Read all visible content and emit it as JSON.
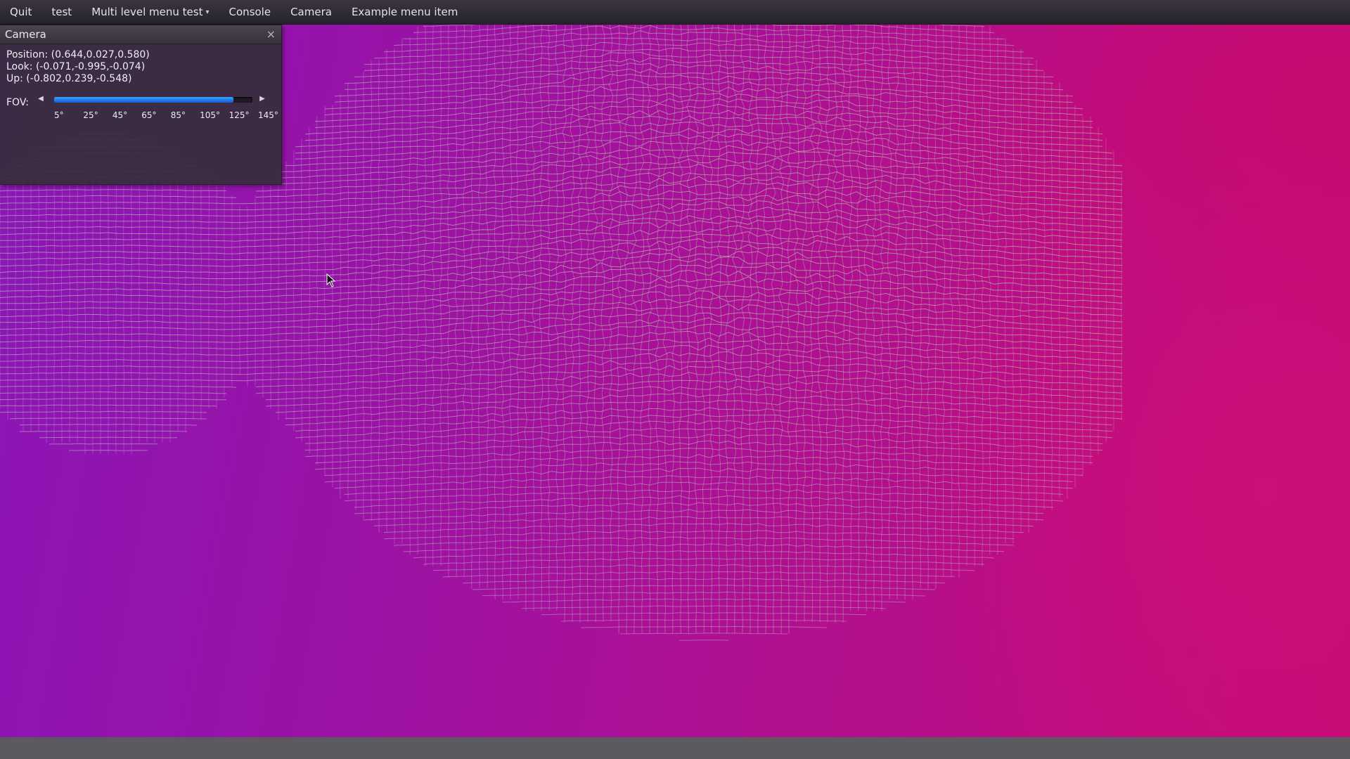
{
  "menubar": {
    "items": [
      "Quit",
      "test",
      "Multi level menu test",
      "Console",
      "Camera",
      "Example menu item"
    ],
    "submenu_caret": "▾"
  },
  "camera_window": {
    "title": "Camera",
    "close": "×",
    "position": "Position: (0.644,0.027,0.580)",
    "look": "Look: (-0.071,-0.995,-0.074)",
    "up": "Up: (-0.802,0.239,-0.548)",
    "fov": {
      "label": "FOV:",
      "ticks": [
        "5°",
        "25°",
        "45°",
        "65°",
        "85°",
        "105°",
        "125°",
        "145°"
      ],
      "min": 5,
      "max": 145,
      "value": 141,
      "left_arrow": "◀",
      "right_arrow": "▶"
    }
  },
  "colors": {
    "accent": "#1a74e8",
    "terrain_low": "#c58fd0",
    "terrain_high": "#b8f0a8"
  },
  "icons": {
    "close": "close-icon",
    "cursor": "mouse-pointer-icon"
  }
}
